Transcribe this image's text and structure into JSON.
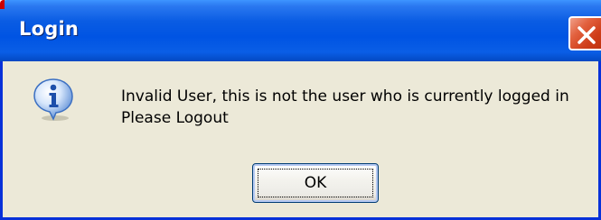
{
  "dialog": {
    "title": "Login",
    "icon": "info-icon",
    "message_line1": "Invalid User, this is not the user who is currently logged in",
    "message_line2": "Please Logout",
    "ok_label": "OK",
    "close_icon": "close-icon"
  },
  "colors": {
    "titlebar": "#0054e3",
    "window_border": "#0831d9",
    "dialog_background": "#ece9d8",
    "close_button": "#e2613e"
  }
}
